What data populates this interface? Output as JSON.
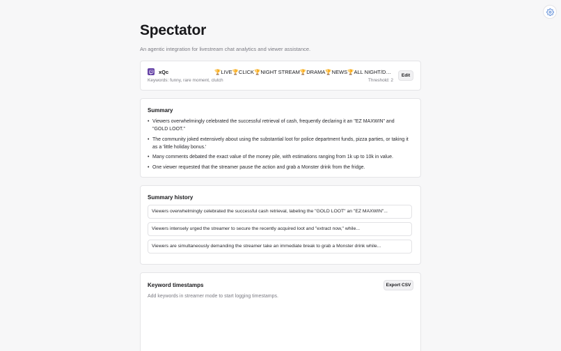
{
  "app": {
    "title": "Spectator",
    "subtitle": "An agentic integration for livestream chat analytics and viewer assistance."
  },
  "icons": {
    "settings": "gear-icon",
    "platform": "twitch-icon"
  },
  "colors": {
    "background": "#f7f7f8",
    "accent": "#6441a5",
    "settings_icon": "#5b8ad6"
  },
  "channel": {
    "name": "xQc",
    "stream_title": "🏆LIVE🏆CLICK🏆NIGHT STREAM🏆DRAMA🏆NEWS🏆ALL NIGHT/DAY🏆RUNS🏆...",
    "keywords": "Keywords: funny, rare moment, clutch",
    "threshold": "Threshold: 2",
    "edit_label": "Edit"
  },
  "summary": {
    "heading": "Summary",
    "bullets": [
      "Viewers overwhelmingly celebrated the successful retrieval of cash, frequently declaring it an \"EZ MAXWIN\" and \"GOLD LOOT.\"",
      "The community joked extensively about using the substantial loot for police department funds, pizza parties, or taking it as a 'little holiday bonus.'",
      "Many comments debated the exact value of the money pile, with estimations ranging from 1k up to 10k in value.",
      "One viewer requested that the streamer pause the action and grab a Monster drink from the fridge."
    ]
  },
  "history": {
    "heading": "Summary history",
    "items": [
      "Viewers overwhelmingly celebrated the successful cash retrieval, labeling the \"GOLD LOOT\" an \"EZ MAXWIN\"...",
      "Viewers intensely urged the streamer to secure the recently acquired loot and \"extract now,\" while...",
      "Viewers are simultaneously demanding the streamer take an immediate break to grab a Monster drink while..."
    ]
  },
  "keyword_timestamps": {
    "heading": "Keyword timestamps",
    "export_label": "Export CSV",
    "empty_text": "Add keywords in streamer mode to start logging timestamps."
  }
}
